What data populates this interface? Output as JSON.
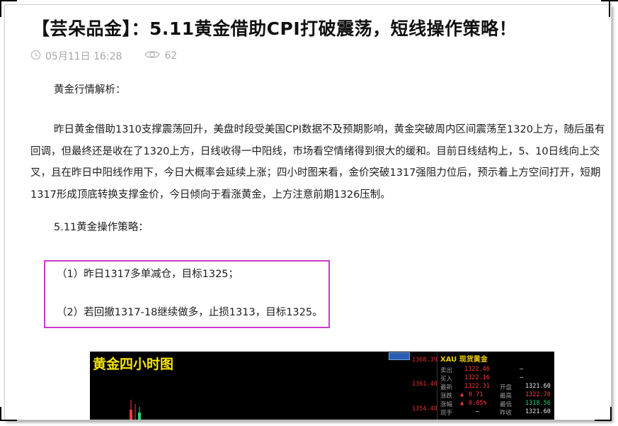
{
  "article": {
    "title": "【芸朵品金】：5.11黄金借助CPI打破震荡，短线操作策略！",
    "date": "05月11日 16:28",
    "views": "62",
    "section1_heading": "黄金行情解析：",
    "section1_paragraph": "昨日黄金借助1310支撑震荡回升，美盘时段受美国CPI数据不及预期影响，黄金突破周内区间震荡至1320上方，随后虽有回调，但最终还是收在了1320上方，日线收得一中阳线，市场看空情绪得到很大的缓和。目前日线结构上，5、10日线向上交叉，且在昨日中阳线作用下，今日大概率会延续上涨；四小时图来看，金价突破1317强阻力位后，预示着上方空间打开，短期1317形成顶底转换支撑金价，今日倾向于看涨黄金，上方注意前期1326压制。",
    "section2_heading": "5.11黄金操作策略：",
    "strategy": {
      "item1": "（1）昨日1317多单减仓，目标1325；",
      "item2": "（2）若回撤1317-18继续做多，止损1313，目标1325。"
    }
  },
  "chart_image": {
    "title": "黄金四小时图",
    "prices": [
      "1368.39",
      "1361.40",
      "1354.40"
    ],
    "panel": {
      "header": "XAU 现货黄金",
      "rows": [
        {
          "label": "卖出",
          "value": "1322.46",
          "label2": "",
          "value2": "–"
        },
        {
          "label": "买入",
          "value": "1322.16",
          "label2": "",
          "value2": "–"
        },
        {
          "label": "最新",
          "value": "1322.31",
          "label2": "开盘",
          "value2": "1321.60"
        },
        {
          "label": "涨跌",
          "value": "0.71",
          "label2": "最高",
          "value2": "1322.70"
        },
        {
          "label": "涨幅",
          "value": "0.05%",
          "label2": "最低",
          "value2": "1318.56"
        },
        {
          "label": "现手",
          "value": "–",
          "label2": "昨收",
          "value2": "1321.60"
        }
      ]
    }
  },
  "colors": {
    "title": "#111111",
    "meta": "#a8a8a8",
    "highlight_border": "#cf39cf",
    "chart_title": "#f5e400"
  }
}
